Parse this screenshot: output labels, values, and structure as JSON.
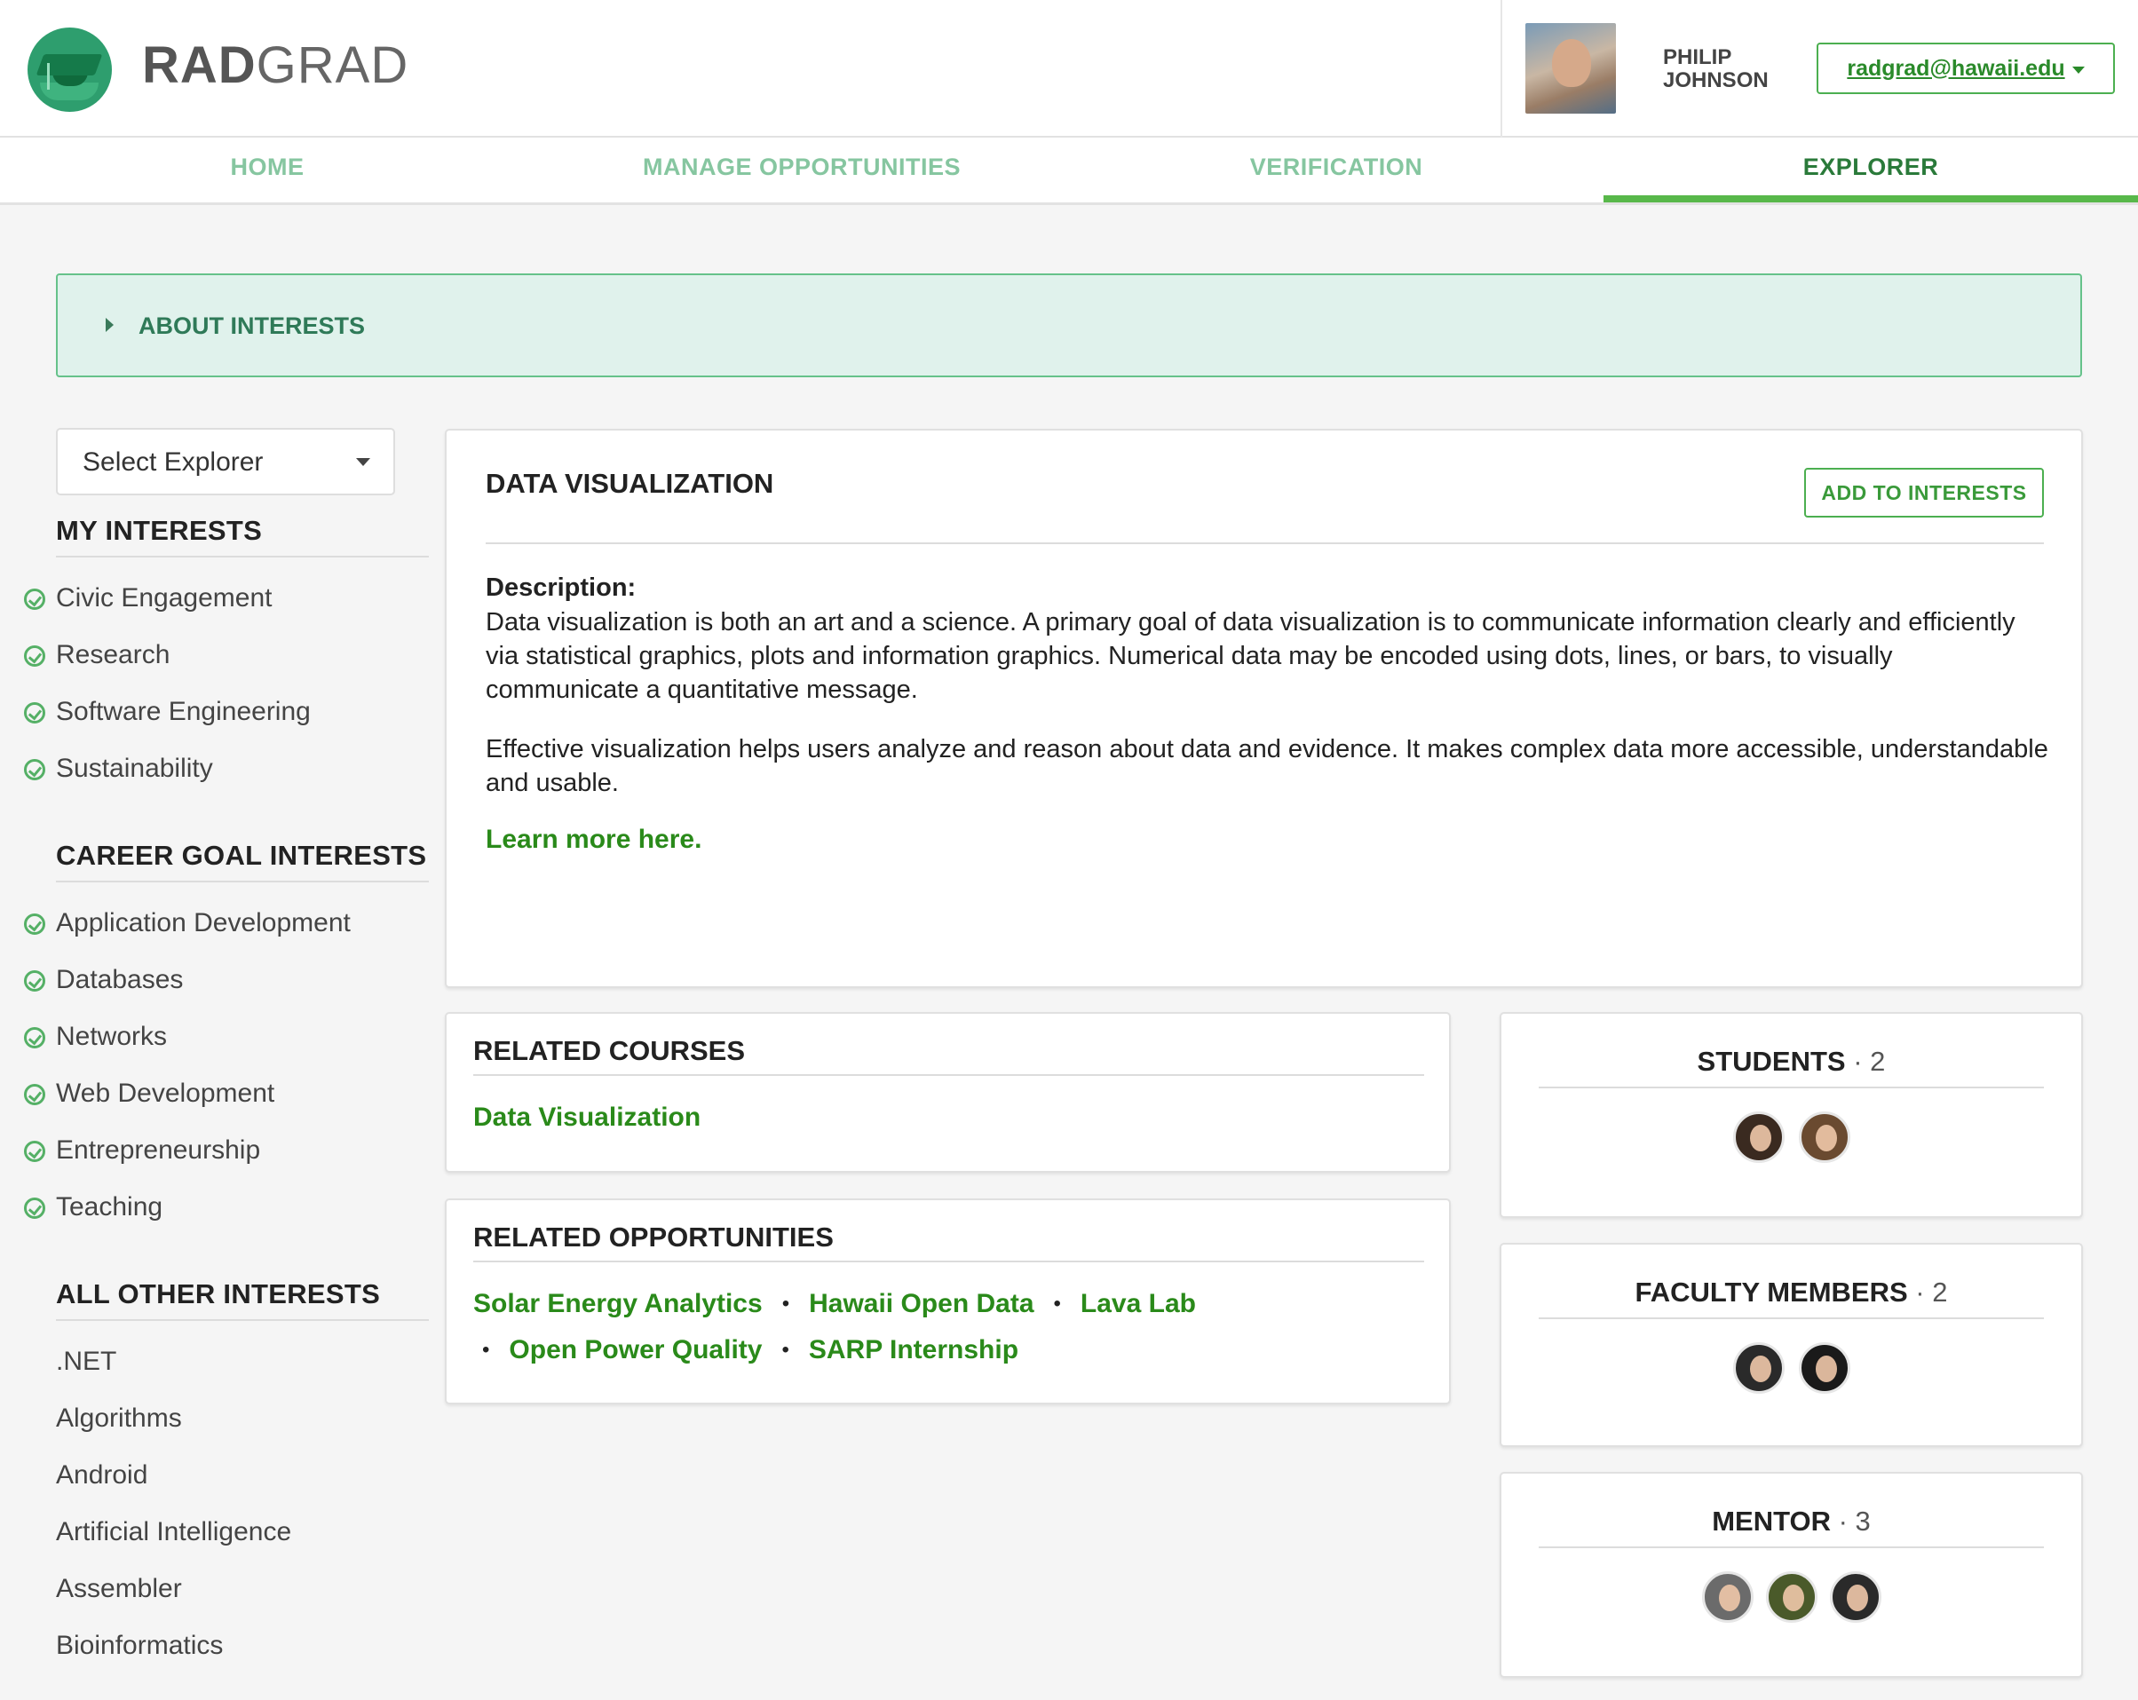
{
  "brand": {
    "part1": "RAD",
    "part2": "GRAD"
  },
  "user": {
    "first": "PHILIP",
    "last": "JOHNSON",
    "email": "radgrad@hawaii.edu"
  },
  "nav": [
    {
      "label": "HOME"
    },
    {
      "label": "MANAGE OPPORTUNITIES"
    },
    {
      "label": "VERIFICATION"
    },
    {
      "label": "EXPLORER"
    }
  ],
  "about": {
    "label": "ABOUT INTERESTS"
  },
  "explorer_select": {
    "value": "Select Explorer"
  },
  "sidebar": {
    "my_interests": {
      "title": "MY INTERESTS",
      "items": [
        "Civic Engagement",
        "Research",
        "Software Engineering",
        "Sustainability"
      ]
    },
    "career_goal_interests": {
      "title": "CAREER GOAL INTERESTS",
      "items": [
        "Application Development",
        "Databases",
        "Networks",
        "Web Development",
        "Entrepreneurship",
        "Teaching"
      ]
    },
    "all_other_interests": {
      "title": "ALL OTHER INTERESTS",
      "items": [
        ".NET",
        "Algorithms",
        "Android",
        "Artificial Intelligence",
        "Assembler",
        "Bioinformatics"
      ]
    }
  },
  "interest": {
    "title": "DATA VISUALIZATION",
    "add_button": "ADD TO INTERESTS",
    "description_label": "Description:",
    "description_p1": "Data visualization is both an art and a science. A primary goal of data visualization is to communicate information clearly and efficiently via statistical graphics, plots and information graphics. Numerical data may be encoded using dots, lines, or bars, to visually communicate a quantitative message.",
    "description_p2": "Effective visualization helps users analyze and reason about data and evidence. It makes complex data more accessible, understandable and usable.",
    "learn_more": "Learn more here."
  },
  "related_courses": {
    "title": "RELATED COURSES",
    "items": [
      "Data Visualization"
    ]
  },
  "related_opportunities": {
    "title": "RELATED OPPORTUNITIES",
    "items": [
      "Solar Energy Analytics",
      "Hawaii Open Data",
      "Lava Lab",
      "Open Power Quality",
      "SARP Internship"
    ]
  },
  "students": {
    "title": "STUDENTS",
    "count": "· 2"
  },
  "faculty": {
    "title": "FACULTY MEMBERS",
    "count": "· 2"
  },
  "mentor": {
    "title": "MENTOR",
    "count": "· 3"
  },
  "colors": {
    "accent": "#2a8a1a",
    "nav_inactive": "#86c6a0",
    "banner_bg": "#e0f2ec"
  }
}
